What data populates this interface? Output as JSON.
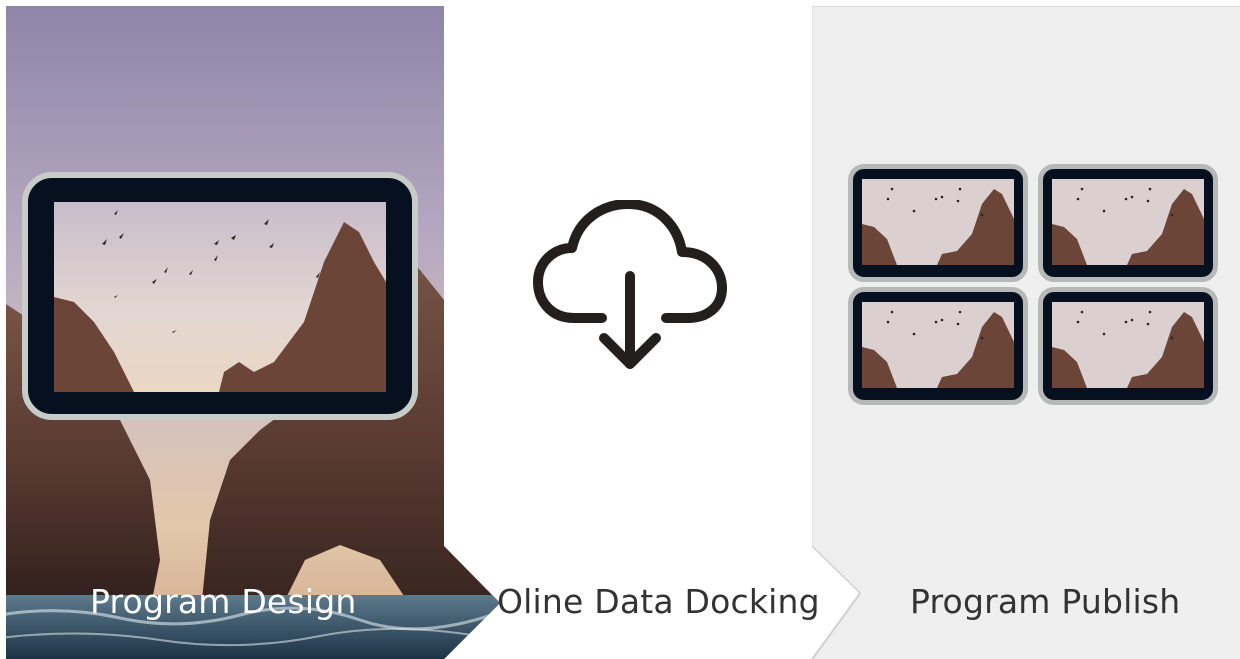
{
  "steps": [
    {
      "label": "Program Design"
    },
    {
      "label": "Oline Data Docking"
    },
    {
      "label": "Program Publish"
    }
  ],
  "icons": {
    "download": "cloud-download-icon"
  },
  "colors": {
    "screen_bezel": "#06101f",
    "publish_bg": "#efefef",
    "icon_stroke": "#231f1f"
  }
}
